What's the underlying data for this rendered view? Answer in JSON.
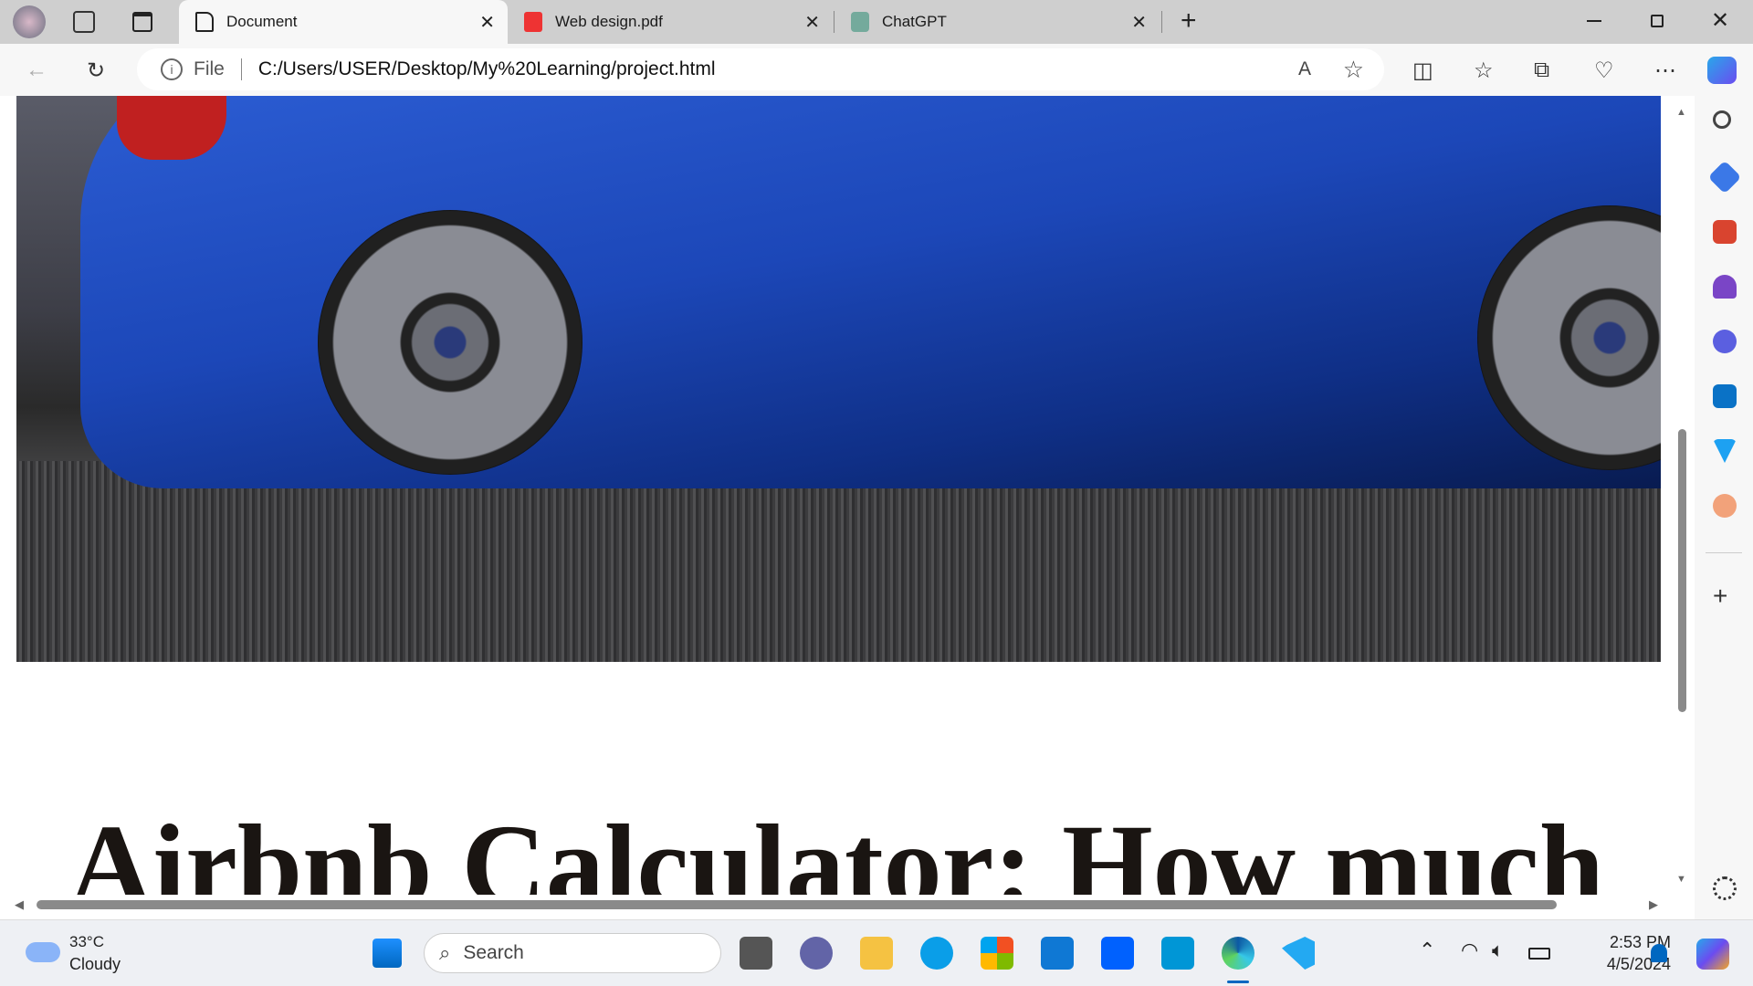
{
  "browser": {
    "tabs": [
      {
        "label": "Document",
        "active": true
      },
      {
        "label": "Web design.pdf",
        "active": false
      },
      {
        "label": "ChatGPT",
        "active": false
      }
    ],
    "address": {
      "scheme_label": "File",
      "url": "C:/Users/USER/Desktop/My%20Learning/project.html"
    }
  },
  "page": {
    "heading": "Airbnb Calculator: How much"
  },
  "taskbar": {
    "weather_temp": "33°C",
    "weather_desc": "Cloudy",
    "search_placeholder": "Search",
    "time": "2:53 PM",
    "date": "4/5/2024"
  }
}
